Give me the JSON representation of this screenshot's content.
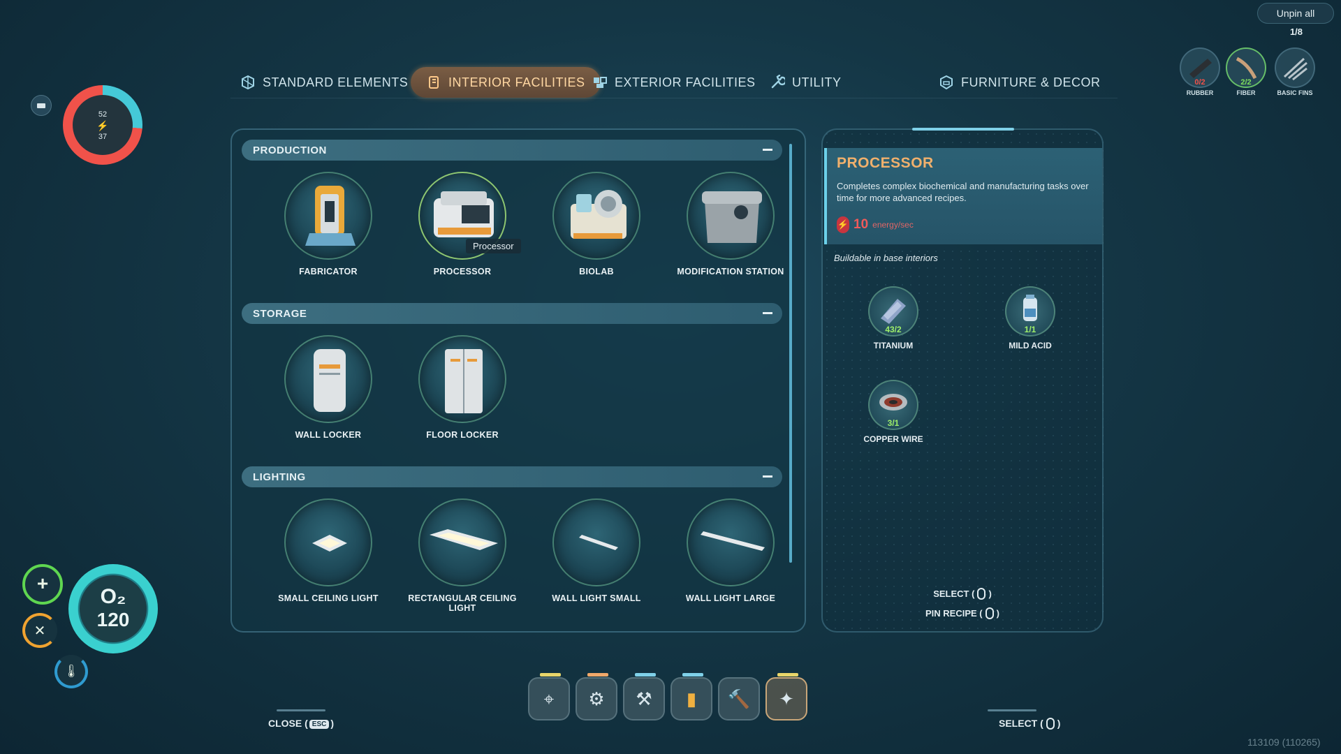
{
  "tabs": [
    {
      "label": "STANDARD ELEMENTS",
      "icon": "standard-elements-icon",
      "active": false
    },
    {
      "label": "INTERIOR FACILITIES",
      "icon": "interior-facilities-icon",
      "active": true
    },
    {
      "label": "EXTERIOR FACILITIES",
      "icon": "exterior-facilities-icon",
      "active": false
    },
    {
      "label": "UTILITY",
      "icon": "wrench-icon",
      "active": false
    },
    {
      "label": "FURNITURE & DECOR",
      "icon": "furniture-icon",
      "active": false
    }
  ],
  "hud": {
    "health_top": "52",
    "health_bottom": "37",
    "o2_label": "O₂",
    "o2_value": "120"
  },
  "sections": [
    {
      "title": "PRODUCTION",
      "items": [
        {
          "name": "FABRICATOR",
          "icon": "fabricator-icon"
        },
        {
          "name": "PROCESSOR",
          "icon": "processor-icon",
          "tooltip": "Processor"
        },
        {
          "name": "BIOLAB",
          "icon": "biolab-icon"
        },
        {
          "name": "MODIFICATION STATION",
          "icon": "modification-station-icon"
        }
      ]
    },
    {
      "title": "STORAGE",
      "items": [
        {
          "name": "WALL LOCKER",
          "icon": "wall-locker-icon"
        },
        {
          "name": "FLOOR LOCKER",
          "icon": "floor-locker-icon"
        }
      ]
    },
    {
      "title": "LIGHTING",
      "items": [
        {
          "name": "SMALL CEILING LIGHT",
          "icon": "small-ceiling-light-icon"
        },
        {
          "name": "RECTANGULAR CEILING LIGHT",
          "icon": "rectangular-ceiling-light-icon"
        },
        {
          "name": "WALL LIGHT SMALL",
          "icon": "wall-light-small-icon"
        },
        {
          "name": "WALL LIGHT LARGE",
          "icon": "wall-light-large-icon"
        }
      ]
    }
  ],
  "detail": {
    "title": "PROCESSOR",
    "description": "Completes complex biochemical and manufacturing tasks over time for more advanced recipes.",
    "energy_value": "10",
    "energy_unit": "energy/sec",
    "buildable": "Buildable in base interiors",
    "ingredients": [
      {
        "name": "TITANIUM",
        "count": "43/2",
        "icon": "titanium-icon"
      },
      {
        "name": "MILD ACID",
        "count": "1/1",
        "icon": "mild-acid-icon"
      },
      {
        "name": "COPPER WIRE",
        "count": "3/1",
        "icon": "copper-wire-icon"
      }
    ],
    "select_hint": "SELECT (",
    "pin_hint": "PIN RECIPE (",
    "hint_close": ")"
  },
  "pinned": {
    "unpin_label": "Unpin all",
    "count": "1/8",
    "items": [
      {
        "name": "RUBBER",
        "qty": "0/2",
        "qty_color": "#f0524a",
        "icon": "rubber-icon"
      },
      {
        "name": "FIBER",
        "qty": "2/2",
        "qty_color": "#7fe05a",
        "icon": "fiber-icon"
      },
      {
        "name": "BASIC FINS",
        "qty": "",
        "qty_color": "#e6f0f3",
        "icon": "basic-fins-icon"
      }
    ]
  },
  "hotbar": [
    {
      "icon": "scanner-icon",
      "bar_color": "#e8d56a"
    },
    {
      "icon": "drill-icon",
      "bar_color": "#f0a86a"
    },
    {
      "icon": "repair-tool-icon",
      "bar_color": "#7fd0e8"
    },
    {
      "icon": "battery-icon",
      "bar_color": "#7fd0e8"
    },
    {
      "icon": "hammer-icon",
      "bar_color": ""
    },
    {
      "icon": "builder-tool-icon",
      "bar_color": "#e8d56a"
    }
  ],
  "footer": {
    "close_label": "CLOSE (",
    "esc_key": "ESC",
    "close_end": ")",
    "select_label": "SELECT (",
    "select_end": ")",
    "version": "113109 (110265)"
  }
}
